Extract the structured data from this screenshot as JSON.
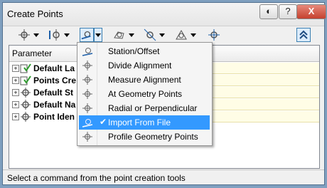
{
  "window": {
    "title": "Create Points"
  },
  "titlebar_buttons": [
    {
      "name": "options",
      "glyph": "◐"
    },
    {
      "name": "help",
      "glyph": "?"
    },
    {
      "name": "close",
      "glyph": "X"
    }
  ],
  "panel": {
    "column_header": "Parameter"
  },
  "tree_rows": [
    {
      "label": "Default La",
      "icon": "layer-icon"
    },
    {
      "label": "Points Cre",
      "icon": "layer-icon"
    },
    {
      "label": "Default St",
      "icon": "point-style-icon"
    },
    {
      "label": "Default Na",
      "icon": "point-style-icon"
    },
    {
      "label": "Point Iden",
      "icon": "point-style-icon"
    }
  ],
  "menu": {
    "items": [
      {
        "label": "Station/Offset",
        "selected": false
      },
      {
        "label": "Divide Alignment",
        "selected": false
      },
      {
        "label": "Measure Alignment",
        "selected": false
      },
      {
        "label": "At Geometry Points",
        "selected": false
      },
      {
        "label": "Radial or Perpendicular",
        "selected": false
      },
      {
        "label": "Import From File",
        "selected": true
      },
      {
        "label": "Profile Geometry Points",
        "selected": false
      }
    ]
  },
  "status": {
    "text": "Select a command from the point creation tools"
  },
  "colors": {
    "selection": "#3399ff",
    "value_cell": "#fffde6",
    "accent_blue": "#1e5fa8"
  }
}
